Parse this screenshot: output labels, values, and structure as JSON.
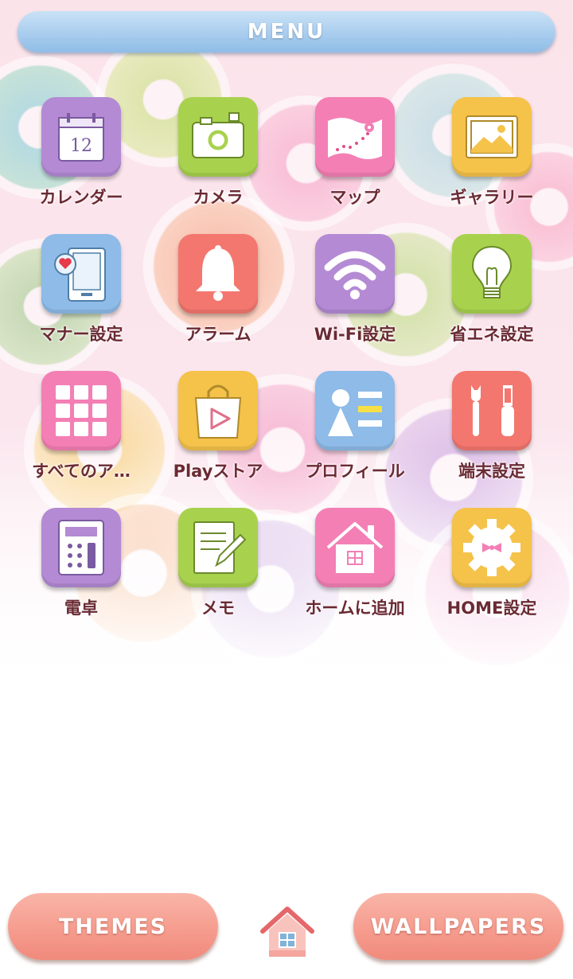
{
  "header": {
    "title": "MENU"
  },
  "apps": [
    {
      "label": "カレンダー",
      "icon": "calendar-icon",
      "color": "#b58ad6",
      "calendar_day": "12"
    },
    {
      "label": "カメラ",
      "icon": "camera-icon",
      "color": "#a8d24e"
    },
    {
      "label": "マップ",
      "icon": "map-icon",
      "color": "#f37fb5"
    },
    {
      "label": "ギャラリー",
      "icon": "gallery-icon",
      "color": "#f5c24a"
    },
    {
      "label": "マナー設定",
      "icon": "manner-mode-icon",
      "color": "#8ebbe8"
    },
    {
      "label": "アラーム",
      "icon": "bell-icon",
      "color": "#f3776f"
    },
    {
      "label": "Wi-Fi設定",
      "icon": "wifi-icon",
      "color": "#b48ad4"
    },
    {
      "label": "省エネ設定",
      "icon": "lightbulb-icon",
      "color": "#a8d24e"
    },
    {
      "label": "すべてのア…",
      "icon": "all-apps-grid-icon",
      "color": "#f37fb5"
    },
    {
      "label": "Playストア",
      "icon": "play-store-bag-icon",
      "color": "#f5c24a"
    },
    {
      "label": "プロフィール",
      "icon": "profile-icon",
      "color": "#8ebbe8"
    },
    {
      "label": "端末設定",
      "icon": "tools-icon",
      "color": "#f3776f"
    },
    {
      "label": "電卓",
      "icon": "calculator-icon",
      "color": "#b48ad4"
    },
    {
      "label": "メモ",
      "icon": "memo-pencil-icon",
      "color": "#a8d24e"
    },
    {
      "label": "ホームに追加",
      "icon": "house-icon",
      "color": "#f37fb5"
    },
    {
      "label": "HOME設定",
      "icon": "gear-ribbon-icon",
      "color": "#f5c24a"
    }
  ],
  "bottom": {
    "themes_label": "THEMES",
    "wallpapers_label": "WALLPAPERS",
    "home_icon": "home-icon"
  }
}
